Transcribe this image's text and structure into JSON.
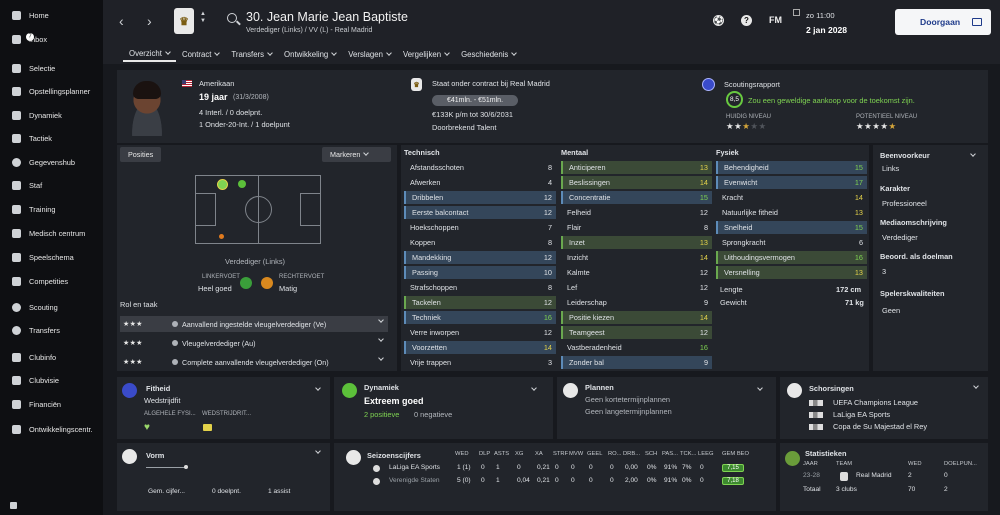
{
  "sidebar": {
    "items": [
      {
        "label": "Home",
        "icon": "home-icon",
        "badge": ""
      },
      {
        "label": "Inbox",
        "icon": "inbox-icon",
        "badge": "7"
      },
      {
        "label": "Selectie",
        "icon": "squad-icon",
        "badge": ""
      },
      {
        "label": "Opstellingsplanner",
        "icon": "clipboard-icon",
        "badge": ""
      },
      {
        "label": "Dynamiek",
        "icon": "dynamics-icon",
        "badge": ""
      },
      {
        "label": "Tactiek",
        "icon": "tactics-icon",
        "badge": ""
      },
      {
        "label": "Gegevenshub",
        "icon": "data-hub-icon",
        "badge": ""
      },
      {
        "label": "Staf",
        "icon": "staff-icon",
        "badge": ""
      },
      {
        "label": "Training",
        "icon": "training-icon",
        "badge": ""
      },
      {
        "label": "Medisch centrum",
        "icon": "medical-icon",
        "badge": ""
      },
      {
        "label": "Speelschema",
        "icon": "calendar-icon",
        "badge": ""
      },
      {
        "label": "Competities",
        "icon": "trophy-icon",
        "badge": ""
      },
      {
        "label": "Scouting",
        "icon": "scouting-icon",
        "badge": ""
      },
      {
        "label": "Transfers",
        "icon": "transfers-icon",
        "badge": ""
      },
      {
        "label": "Clubinfo",
        "icon": "club-info-icon",
        "badge": ""
      },
      {
        "label": "Clubvisie",
        "icon": "club-vision-icon",
        "badge": ""
      },
      {
        "label": "Financiën",
        "icon": "finances-icon",
        "badge": ""
      },
      {
        "label": "Ontwikkelingscentr.",
        "icon": "development-icon",
        "badge": ""
      }
    ]
  },
  "header": {
    "player_name": "30. Jean Marie Jean Baptiste",
    "subtitle": "Verdediger (Links) / VV (L) - Real Madrid",
    "fm_label": "FM",
    "time": "zo 11:00",
    "date": "2 jan 2028",
    "continue_label": "Doorgaan",
    "help_label": "?",
    "tabs": [
      {
        "label": "Overzicht",
        "active": true
      },
      {
        "label": "Contract",
        "active": false
      },
      {
        "label": "Transfers",
        "active": false
      },
      {
        "label": "Ontwikkeling",
        "active": false
      },
      {
        "label": "Verslagen",
        "active": false
      },
      {
        "label": "Vergelijken",
        "active": false
      },
      {
        "label": "Geschiedenis",
        "active": false
      }
    ]
  },
  "profile": {
    "nationality": "Amerikaan",
    "age": "19 jaar",
    "dob": "(31/3/2008)",
    "caps": "4 Interl. / 0 doelpnt.",
    "u20": "1 Onder-20-Int. / 1 doelpunt"
  },
  "contract": {
    "status": "Staat onder contract bij Real Madrid",
    "value_range": "€41mln. - €51mln.",
    "wage": "€133K p/m tot 30/6/2031",
    "tag": "Doorbrekend Talent"
  },
  "scouting": {
    "title": "Scoutingsrapport",
    "score": "8,5",
    "summary": "Zou een geweldige aankoop voor de toekomst zijn.",
    "current_label": "HUIDIG NIVEAU",
    "potential_label": "POTENTIEEL NIVEAU",
    "current_stars": 2.5,
    "potential_stars": 5
  },
  "positions": {
    "button": "Posities",
    "mark_button": "Markeren",
    "position_label": "Verdediger (Links)",
    "left_foot_label": "LINKERVOET",
    "left_foot_value": "Heel goed",
    "right_foot_label": "RECHTERVOET",
    "right_foot_value": "Matig"
  },
  "roles": {
    "title": "Rol en taak",
    "items": [
      {
        "stars": "★★★",
        "label": "Aanvallend ingestelde vleugelverdediger (Ve)",
        "selected": true
      },
      {
        "stars": "★★★",
        "label": "Vleugelverdediger (Au)",
        "selected": false
      },
      {
        "stars": "★★★",
        "label": "Complete aanvallende vleugelverdediger (On)",
        "selected": false
      }
    ]
  },
  "attributes": {
    "technical_title": "Technisch",
    "mental_title": "Mentaal",
    "physical_title": "Fysiek",
    "technical": [
      {
        "name": "Afstandsschoten",
        "value": "8",
        "hl": ""
      },
      {
        "name": "Afwerken",
        "value": "4",
        "hl": ""
      },
      {
        "name": "Dribbelen",
        "value": "12",
        "hl": "blue"
      },
      {
        "name": "Eerste balcontact",
        "value": "12",
        "hl": "blue"
      },
      {
        "name": "Hoekschoppen",
        "value": "7",
        "hl": ""
      },
      {
        "name": "Koppen",
        "value": "8",
        "hl": ""
      },
      {
        "name": "Mandekking",
        "value": "12",
        "hl": "blue"
      },
      {
        "name": "Passing",
        "value": "10",
        "hl": "blue"
      },
      {
        "name": "Strafschoppen",
        "value": "8",
        "hl": ""
      },
      {
        "name": "Tackelen",
        "value": "12",
        "hl": "green"
      },
      {
        "name": "Techniek",
        "value": "16",
        "hl": "blue"
      },
      {
        "name": "Verre inworpen",
        "value": "12",
        "hl": ""
      },
      {
        "name": "Voorzetten",
        "value": "14",
        "hl": "blue"
      },
      {
        "name": "Vrije trappen",
        "value": "3",
        "hl": ""
      }
    ],
    "mental": [
      {
        "name": "Anticiperen",
        "value": "13",
        "hl": "green"
      },
      {
        "name": "Beslissingen",
        "value": "14",
        "hl": "green"
      },
      {
        "name": "Concentratie",
        "value": "15",
        "hl": "blue"
      },
      {
        "name": "Felheid",
        "value": "12",
        "hl": ""
      },
      {
        "name": "Flair",
        "value": "8",
        "hl": ""
      },
      {
        "name": "Inzet",
        "value": "13",
        "hl": "green"
      },
      {
        "name": "Inzicht",
        "value": "14",
        "hl": ""
      },
      {
        "name": "Kalmte",
        "value": "12",
        "hl": ""
      },
      {
        "name": "Lef",
        "value": "12",
        "hl": ""
      },
      {
        "name": "Leiderschap",
        "value": "9",
        "hl": ""
      },
      {
        "name": "Positie kiezen",
        "value": "14",
        "hl": "green"
      },
      {
        "name": "Teamgeest",
        "value": "12",
        "hl": "green"
      },
      {
        "name": "Vastberadenheid",
        "value": "16",
        "hl": ""
      },
      {
        "name": "Zonder bal",
        "value": "9",
        "hl": "blue"
      }
    ],
    "physical": [
      {
        "name": "Behendigheid",
        "value": "15",
        "hl": "blue"
      },
      {
        "name": "Evenwicht",
        "value": "17",
        "hl": "blue"
      },
      {
        "name": "Kracht",
        "value": "14",
        "hl": ""
      },
      {
        "name": "Natuurlijke fitheid",
        "value": "13",
        "hl": ""
      },
      {
        "name": "Snelheid",
        "value": "15",
        "hl": "blue"
      },
      {
        "name": "Sprongkracht",
        "value": "6",
        "hl": ""
      },
      {
        "name": "Uithoudingsvermogen",
        "value": "16",
        "hl": "green"
      },
      {
        "name": "Versnelling",
        "value": "13",
        "hl": "green"
      }
    ],
    "length_label": "Lengte",
    "length_value": "172 cm",
    "weight_label": "Gewicht",
    "weight_value": "71 kg"
  },
  "right_info": {
    "foot_label": "Beenvoorkeur",
    "foot_value": "Links",
    "character_label": "Karakter",
    "character_value": "Professioneel",
    "media_label": "Mediaomschrijving",
    "media_value": "Verdediger",
    "gk_label": "Beoord. als doelman",
    "gk_value": "3",
    "traits_label": "Spelerskwaliteiten",
    "traits_value": "Geen"
  },
  "cards": {
    "fitness_title": "Fitheid",
    "fitness_value": "Wedstrijdfit",
    "fitness_col1": "ALGEHELE FYSI...",
    "fitness_col2": "WEDSTRIJDRIT...",
    "dynamics_title": "Dynamiek",
    "dynamics_value": "Extreem goed",
    "dynamics_pos": "2 positieve",
    "dynamics_neg": "0 negatieve",
    "plans_title": "Plannen",
    "plans_short": "Geen kortetermijnplannen",
    "plans_long": "Geen langetermijnplannen",
    "suspensions_title": "Schorsingen",
    "suspensions": [
      "UEFA Champions League",
      "LaLiga EA Sports",
      "Copa de Su Majestad el Rey"
    ]
  },
  "form": {
    "title": "Vorm",
    "avg_label": "Gem. cijfer...",
    "goals": "0 doelpnt.",
    "assists": "1 assist"
  },
  "season_stats": {
    "title": "Seizoenscijfers",
    "headers": [
      "WED",
      "DLP",
      "ASTS",
      "XG",
      "XA",
      "STRF",
      "MVW",
      "GEEL",
      "RO...",
      "DRB...",
      "SCH",
      "PAS...",
      "TCK...",
      "LEEG",
      "GEM BEO"
    ],
    "rows": [
      {
        "comp": "LaLiga EA Sports",
        "values": [
          "1 (1)",
          "0",
          "1",
          "0",
          "0,21",
          "0",
          "0",
          "0",
          "0",
          "0,00",
          "0%",
          "91%",
          "7%",
          "0"
        ],
        "rating": "7,15"
      },
      {
        "comp": "Verenigde Staten",
        "values": [
          "5 (0)",
          "0",
          "1",
          "0,04",
          "0,21",
          "0",
          "0",
          "0",
          "0",
          "2,00",
          "0%",
          "91%",
          "0%",
          "0"
        ],
        "rating": "7,18"
      }
    ]
  },
  "statistics": {
    "title": "Statistieken",
    "headers": [
      "JAAR",
      "TEAM",
      "WED",
      "DOELPUN..."
    ],
    "rows": [
      {
        "year": "23-28",
        "team": "Real Madrid",
        "apps": "2",
        "goals": "0"
      },
      {
        "year": "Totaal",
        "team": "3 clubs",
        "apps": "70",
        "goals": "2"
      }
    ]
  },
  "colors": {
    "accent_green": "#7fd352",
    "highlight_blue": "#34465a",
    "highlight_green": "#3b4a37",
    "button_blue_text": "#1e3a8a"
  }
}
